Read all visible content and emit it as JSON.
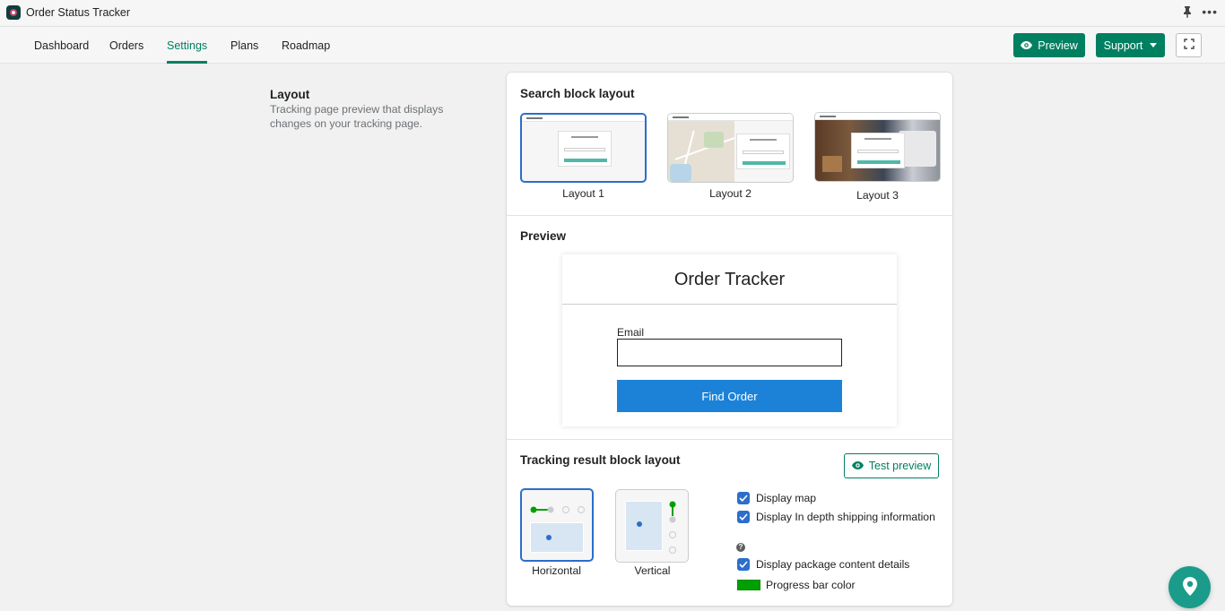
{
  "app": {
    "title": "Order Status Tracker"
  },
  "nav": {
    "tabs": [
      {
        "label": "Dashboard"
      },
      {
        "label": "Orders"
      },
      {
        "label": "Settings"
      },
      {
        "label": "Plans"
      },
      {
        "label": "Roadmap"
      }
    ],
    "active_tab": "Settings",
    "preview_label": "Preview",
    "support_label": "Support"
  },
  "layout_section": {
    "title": "Layout",
    "description": "Tracking page preview that displays changes on your tracking page."
  },
  "search_block": {
    "title": "Search block layout",
    "options": [
      {
        "label": "Layout 1",
        "selected": true
      },
      {
        "label": "Layout 2",
        "selected": false
      },
      {
        "label": "Layout 3",
        "selected": false
      }
    ]
  },
  "preview": {
    "title": "Preview",
    "tracker_title": "Order Tracker",
    "email_label": "Email",
    "email_value": "",
    "button_label": "Find Order"
  },
  "tracking_result": {
    "title": "Tracking result block layout",
    "test_preview_label": "Test preview",
    "options": [
      {
        "label": "Horizontal",
        "selected": true
      },
      {
        "label": "Vertical",
        "selected": false
      }
    ],
    "checkboxes": [
      {
        "label": "Display map",
        "checked": true
      },
      {
        "label": "Display In depth shipping information",
        "checked": true
      },
      {
        "label": "Display package content details",
        "checked": true
      }
    ],
    "progress_bar_color_label": "Progress bar color",
    "progress_bar_color": "#00a000"
  },
  "colors": {
    "primary": "#008060",
    "selected_border": "#2c6ecb",
    "find_order_button": "#1b82d8",
    "fab": "#1b9c8a"
  },
  "icons": {
    "app": "app-logo-icon",
    "pin": "pin-icon",
    "more": "more-icon",
    "eye": "eye-icon",
    "expand": "fullscreen-icon",
    "help": "help-icon",
    "fab": "map-pin-icon"
  }
}
